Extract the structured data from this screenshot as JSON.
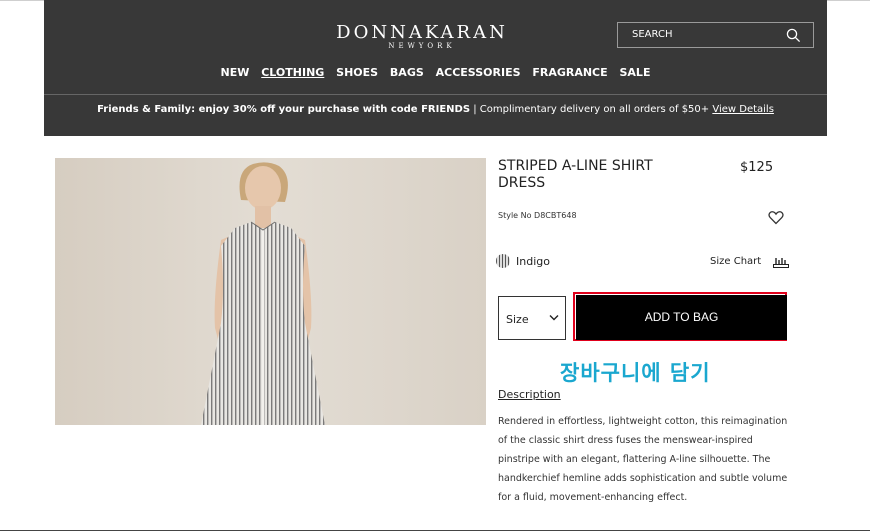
{
  "header": {
    "logo_main": "DONNAKARAN",
    "logo_sub": "NEWYORK",
    "search_label": "SEARCH",
    "nav": [
      "NEW",
      "CLOTHING",
      "SHOES",
      "BAGS",
      "ACCESSORIES",
      "FRAGRANCE",
      "SALE"
    ],
    "active_nav": "CLOTHING",
    "promo_bold": "Friends & Family: enjoy 30% off your purchase with code FRIENDS",
    "promo_rest": " | Complimentary delivery on all orders of $50+ ",
    "promo_link": "View Details"
  },
  "product": {
    "title": "STRIPED A-LINE SHIRT DRESS",
    "price": "$125",
    "style_no": "Style No D8CBT648",
    "color": "Indigo",
    "size_chart": "Size Chart",
    "size_label": "Size",
    "add_to_bag": "ADD TO BAG",
    "annotation": "장바구니에 담기",
    "description_title": "Description",
    "description": "Rendered in effortless, lightweight cotton, this reimagination of the classic shirt dress fuses the menswear-inspired pinstripe with an elegant, flattering A-line silhouette. The handkerchief hemline adds sophistication and subtle volume for a fluid, movement-enhancing effect."
  },
  "icons": {
    "search": "search-icon",
    "heart": "heart-icon",
    "size_chart": "ruler-icon",
    "chevron": "chevron-down-icon"
  },
  "colors": {
    "header_bg": "#383838",
    "button_bg": "#000000",
    "highlight_border": "#e0001b",
    "annotation": "#1aa7cf"
  }
}
